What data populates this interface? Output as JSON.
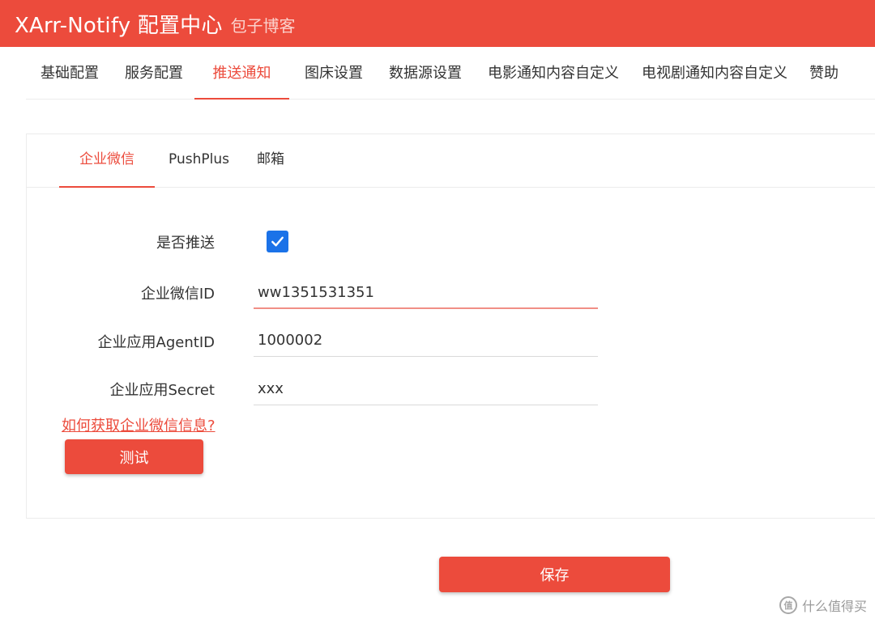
{
  "header": {
    "title": "XArr-Notify 配置中心",
    "subtitle": "包子博客"
  },
  "top_tabs": [
    {
      "label": "基础配置",
      "active": false
    },
    {
      "label": "服务配置",
      "active": false
    },
    {
      "label": "推送通知",
      "active": true
    },
    {
      "label": "图床设置",
      "active": false
    },
    {
      "label": "数据源设置",
      "active": false
    },
    {
      "label": "电影通知内容自定义",
      "active": false
    },
    {
      "label": "电视剧通知内容自定义",
      "active": false
    },
    {
      "label": "赞助",
      "active": false
    }
  ],
  "sub_tabs": [
    {
      "label": "企业微信",
      "active": true
    },
    {
      "label": "PushPlus",
      "active": false
    },
    {
      "label": "邮箱",
      "active": false
    }
  ],
  "form": {
    "push_enabled_label": "是否推送",
    "push_enabled": true,
    "corp_id_label": "企业微信ID",
    "corp_id_value": "ww1351531351",
    "agent_id_label": "企业应用AgentID",
    "agent_id_value": "1000002",
    "secret_label": "企业应用Secret",
    "secret_value": "xxx"
  },
  "help_link": "如何获取企业微信信息?",
  "test_button": "测试",
  "save_button": "保存",
  "watermark": {
    "icon": "zhide-logo-icon",
    "text": "什么值得买"
  },
  "colors": {
    "accent": "#ec4b3c",
    "checkbox": "#1b72e8",
    "focus_underline": "#f18f86"
  }
}
